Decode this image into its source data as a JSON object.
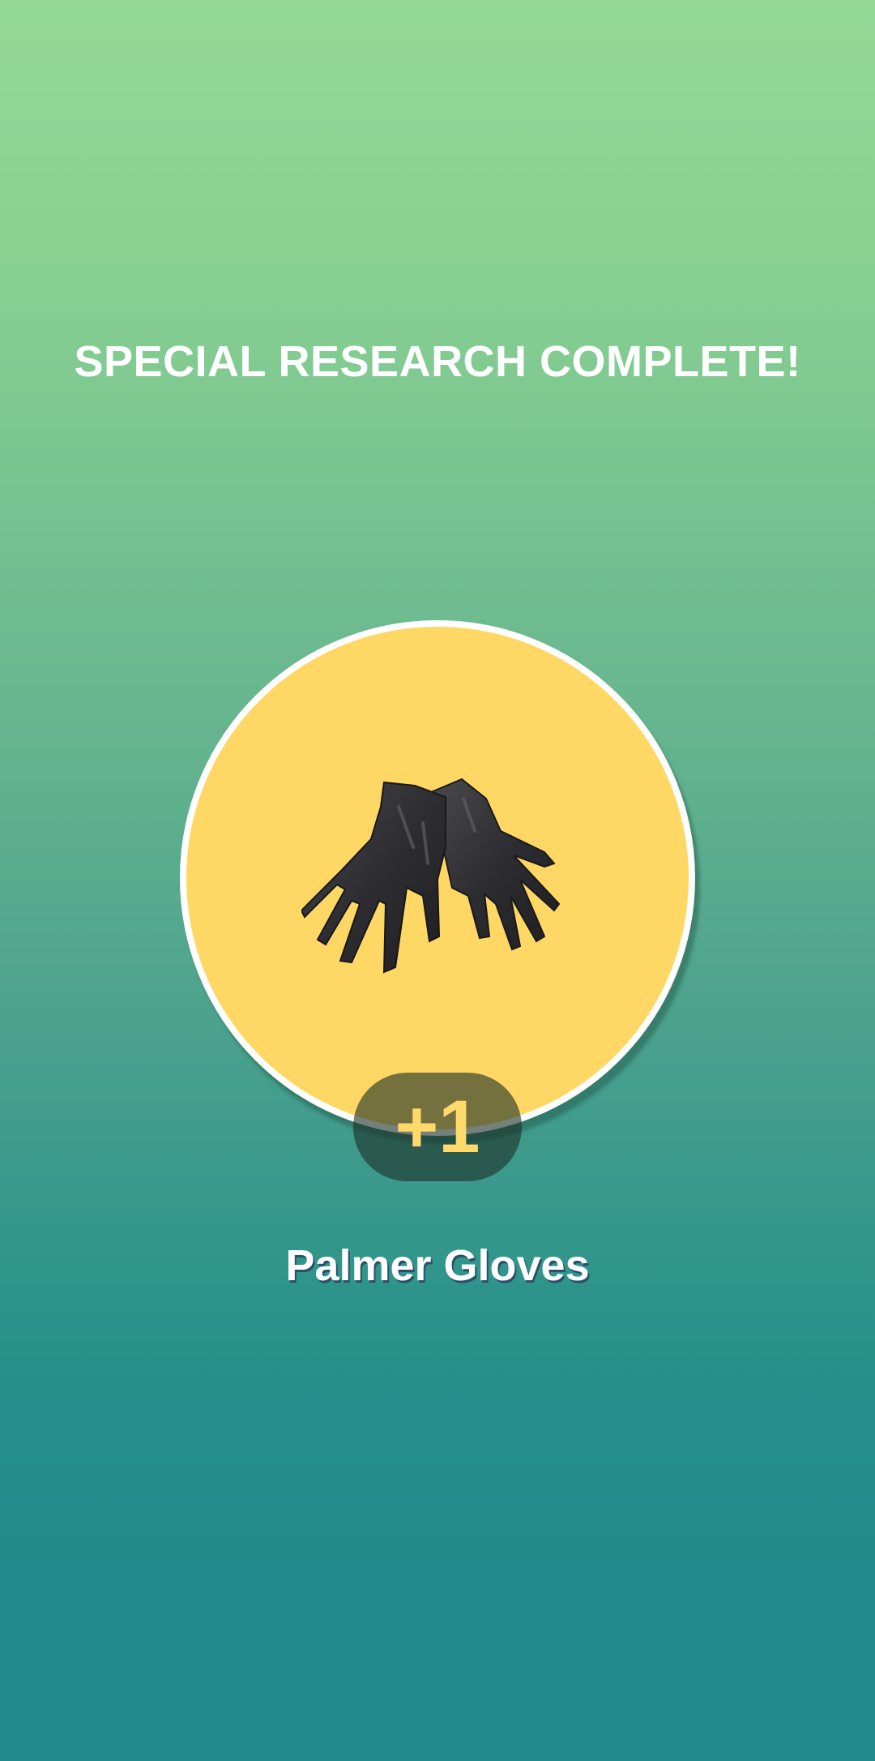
{
  "header": {
    "title": "SPECIAL RESEARCH COMPLETE!"
  },
  "reward": {
    "icon": "gloves-icon",
    "count_label": "+1",
    "item_name": "Palmer Gloves"
  },
  "colors": {
    "background_top": "#93d895",
    "background_bottom": "#238a8b",
    "circle_fill": "#ffd764",
    "count_text": "#ffd96a"
  }
}
